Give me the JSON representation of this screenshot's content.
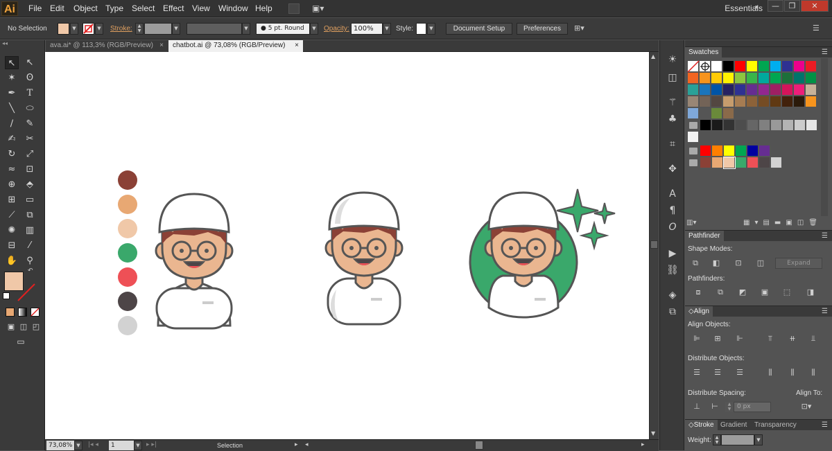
{
  "app": {
    "logo": "Ai",
    "workspace": "Essentials",
    "workspace_arrow": "▾"
  },
  "window_buttons": {
    "minimize": "—",
    "restore": "❐",
    "close": "✕"
  },
  "menu": {
    "items": [
      "File",
      "Edit",
      "Object",
      "Type",
      "Select",
      "Effect",
      "View",
      "Window",
      "Help"
    ]
  },
  "control_bar": {
    "selection": "No Selection",
    "fill_color": "#f0c8a8",
    "stroke_label": "Stroke:",
    "brush_value": "5 pt. Round",
    "opacity_label": "Opacity:",
    "opacity_value": "100%",
    "style_label": "Style:",
    "document_setup": "Document Setup",
    "preferences": "Preferences"
  },
  "doc_tabs": [
    {
      "label": "ava.ai* @ 113,3% (RGB/Preview)",
      "close": "×"
    },
    {
      "label": "chatbot.ai @ 73,08% (RGB/Preview)",
      "close": "×"
    }
  ],
  "status": {
    "zoom": "73,08%",
    "page": "1",
    "tool": "Selection"
  },
  "palette": [
    "#8b4136",
    "#e8a873",
    "#f0c8a8",
    "#3aa86b",
    "#ee5056",
    "#4d4547",
    "#d2d2d2"
  ],
  "swatches_panel": {
    "title": "Swatches",
    "rows": [
      [
        "none",
        "register",
        "#ffffff",
        "#000000",
        "#ff0000",
        "#ffff00",
        "#00a651",
        "#00aeef",
        "#2e3192",
        "#ec008c",
        "#ed1c24"
      ],
      [
        "#f26522",
        "#f7941d",
        "#ffcb05",
        "#fff200",
        "#8dc63f",
        "#39b54a",
        "#00a99d",
        "#00a651",
        "#1d6f3a",
        "#00746b",
        "#009245"
      ],
      [
        "#2aa198",
        "#1b75bc",
        "#0054a6",
        "#262262",
        "#2e3192",
        "#662d91",
        "#92278f",
        "#9e1f63",
        "#d4145a",
        "#ed1e79",
        "#c7b299"
      ],
      [
        "#998675",
        "#736357",
        "#534741",
        "#c69c6d",
        "#a67c52",
        "#8c6239",
        "#754c24",
        "#603913",
        "#42210b",
        "#2b1a0a",
        "#f7941d"
      ],
      [
        "#7fa8d9",
        "#555555",
        "#6a8a3a",
        "#8a6a4a"
      ],
      [
        "#000000",
        "#1a1a1a",
        "#333333",
        "#4d4d4d",
        "#666666",
        "#808080",
        "#999999",
        "#b3b3b3",
        "#cccccc",
        "#e6e6e6"
      ],
      [
        "#f2f2f2"
      ],
      [
        "#ff0000",
        "#ff7f00",
        "#ffff00",
        "#00a651",
        "#0000a0",
        "#662d91"
      ],
      [
        "#8b4136",
        "#e8a873",
        "#f0c8a8",
        "#3aa86b",
        "#ee5056",
        "#4d4547",
        "#d2d2d2"
      ]
    ]
  },
  "pathfinder_panel": {
    "title": "Pathfinder",
    "shape_modes": "Shape Modes:",
    "expand": "Expand",
    "pathfinders": "Pathfinders:"
  },
  "align_panel": {
    "title": "Align",
    "align_objects": "Align Objects:",
    "distribute_objects": "Distribute Objects:",
    "distribute_spacing": "Distribute Spacing:",
    "spacing_value": "0 px",
    "align_to": "Align To:"
  },
  "stroke_panel": {
    "tabs": [
      "Stroke",
      "Gradient",
      "Transparency"
    ],
    "weight_label": "Weight:"
  }
}
